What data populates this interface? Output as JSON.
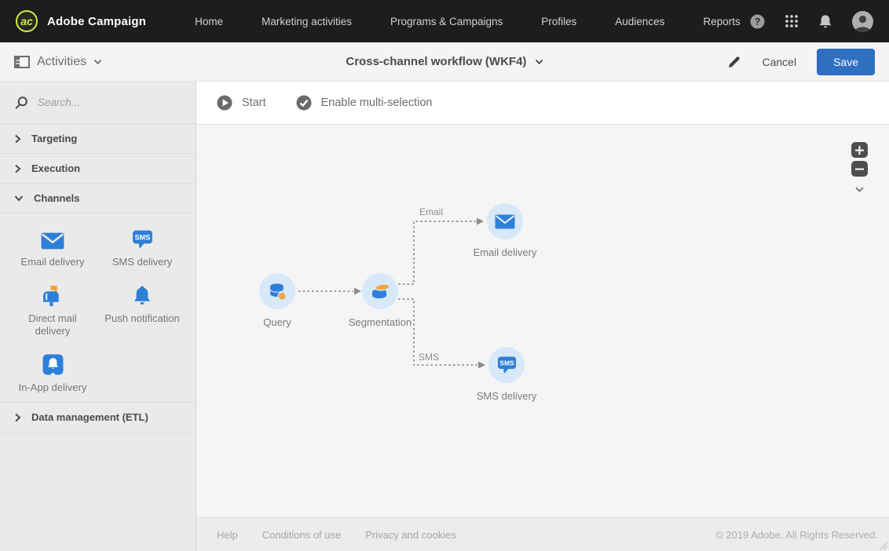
{
  "topnav": {
    "brand": "Adobe Campaign",
    "items": [
      "Home",
      "Marketing activities",
      "Programs & Campaigns",
      "Profiles",
      "Audiences",
      "Reports"
    ],
    "icons": [
      "help-icon",
      "apps-grid-icon",
      "notifications-bell-icon",
      "user-avatar-icon"
    ]
  },
  "header": {
    "context_label": "Activities",
    "title": "Cross-channel workflow (WKF4)",
    "edit_icon": "pencil-icon",
    "cancel_label": "Cancel",
    "save_label": "Save"
  },
  "sidebar": {
    "search_placeholder": "Search...",
    "sections": [
      {
        "label": "Targeting",
        "expanded": false
      },
      {
        "label": "Execution",
        "expanded": false
      },
      {
        "label": "Channels",
        "expanded": true
      },
      {
        "label": "Data management (ETL)",
        "expanded": false
      }
    ],
    "channels": [
      {
        "label": "Email delivery",
        "icon": "email-icon"
      },
      {
        "label": "SMS delivery",
        "icon": "sms-icon"
      },
      {
        "label": "Direct mail delivery",
        "icon": "direct-mail-icon"
      },
      {
        "label": "Push notification",
        "icon": "push-notification-icon"
      },
      {
        "label": "In-App delivery",
        "icon": "in-app-icon"
      }
    ]
  },
  "toolbar": {
    "start_label": "Start",
    "multi_select_label": "Enable multi-selection"
  },
  "canvas": {
    "nodes": [
      {
        "label": "Query",
        "icon": "query-database-icon"
      },
      {
        "label": "Segmentation",
        "icon": "segmentation-icon"
      },
      {
        "label": "Email delivery",
        "icon": "email-icon"
      },
      {
        "label": "SMS delivery",
        "icon": "sms-icon"
      }
    ],
    "connector_labels": {
      "email": "Email",
      "sms": "SMS"
    }
  },
  "icon_text": {
    "sms": "SMS"
  },
  "footer": {
    "links": [
      "Help",
      "Conditions of use",
      "Privacy and cookies"
    ],
    "copyright": "© 2019 Adobe. All Rights Reserved."
  },
  "colors": {
    "accent_blue": "#2e6fc0",
    "icon_blue": "#2e7fd8",
    "icon_orange": "#f2a33c",
    "node_bg": "#d7e8f9",
    "topnav_bg": "#1d1d1d"
  }
}
